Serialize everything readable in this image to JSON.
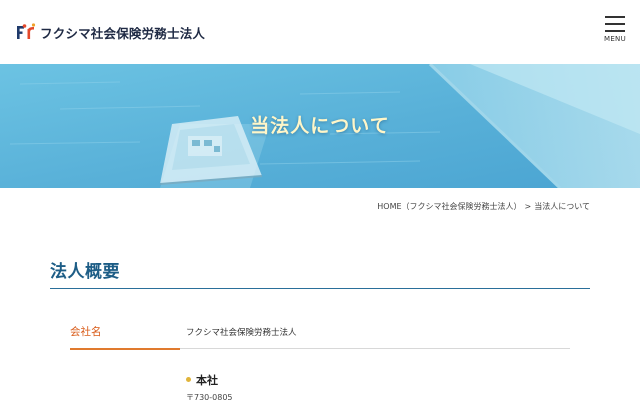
{
  "header": {
    "logo_text": "フクシマ社会保険労務士法人",
    "logo_icon": "fr-logo-icon",
    "menu_label": "MENU",
    "menu_icon": "hamburger-icon"
  },
  "hero": {
    "title": "当法人について"
  },
  "breadcrumb": {
    "home": "HOME（フクシマ社会保険労務士法人）",
    "separator": ">",
    "current": "当法人について"
  },
  "section": {
    "title": "法人概要"
  },
  "company": {
    "label": "会社名",
    "value": "フクシマ社会保険労務士法人"
  },
  "office": {
    "title": "本社",
    "postal": "〒730-0805"
  },
  "colors": {
    "accent_blue": "#1d5d86",
    "accent_orange": "#e07a2e",
    "hero_water": "#5fb6d9",
    "bullet_yellow": "#e0b43a"
  }
}
